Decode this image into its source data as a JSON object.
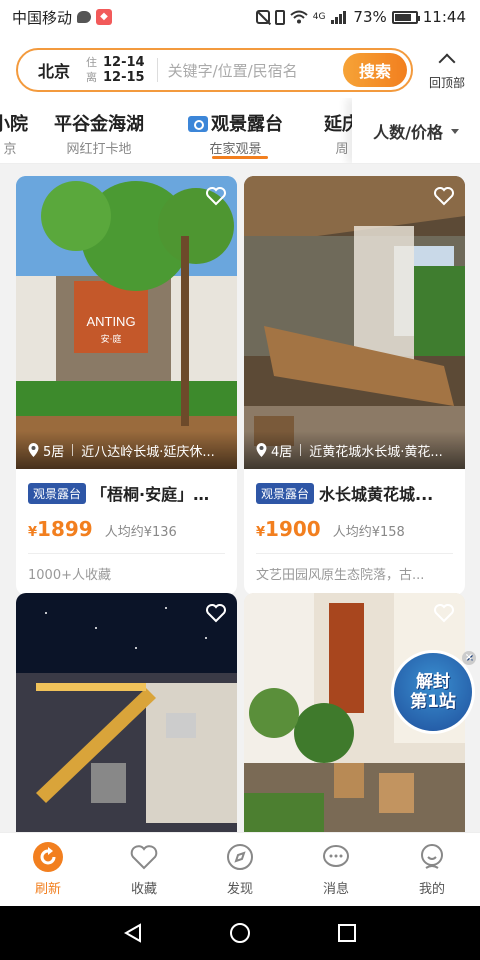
{
  "status_bar": {
    "carrier": "中国移动",
    "network": "4G",
    "battery": "73%",
    "time": "11:44"
  },
  "header": {
    "city": "北京",
    "checkin_label": "住",
    "checkin_date": "12-14",
    "checkout_label": "离",
    "checkout_date": "12-15",
    "search_placeholder": "关键字/位置/民宿名",
    "search_button": "搜索",
    "back_to_top": "回顶部"
  },
  "tabs": [
    {
      "title": "小院",
      "subtitle": "京"
    },
    {
      "title": "平谷金海湖",
      "subtitle": "网红打卡地"
    },
    {
      "title": "观景露台",
      "subtitle": "在家观景",
      "active": true
    },
    {
      "title": "延庆",
      "subtitle": "周"
    }
  ],
  "filter": {
    "label": "人数/价格"
  },
  "cards": [
    {
      "rooms": "5居",
      "location": "近八达岭长城·延庆休...",
      "tag": "观景露台",
      "title": "「梧桐·安庭」轻...",
      "price_symbol": "¥",
      "price": "1899",
      "per_person": "人均约¥136",
      "subtitle": "1000+人收藏",
      "sign_text": "ANTING",
      "sign_sub": "安·庭"
    },
    {
      "rooms": "4居",
      "location": "近黄花城水长城·黄花...",
      "tag": "观景露台",
      "title": "水长城黄花城...",
      "price_symbol": "¥",
      "price": "1900",
      "per_person": "人均约¥158",
      "subtitle": "文艺田园风原生态院落，古..."
    },
    {},
    {}
  ],
  "promo": {
    "line1": "解封",
    "line2": "第1站"
  },
  "bottom_nav": [
    {
      "label": "刷新",
      "active": true
    },
    {
      "label": "收藏"
    },
    {
      "label": "发现"
    },
    {
      "label": "消息"
    },
    {
      "label": "我的"
    }
  ],
  "colors": {
    "accent": "#f27f1f",
    "tag_blue": "#2e56a6"
  }
}
